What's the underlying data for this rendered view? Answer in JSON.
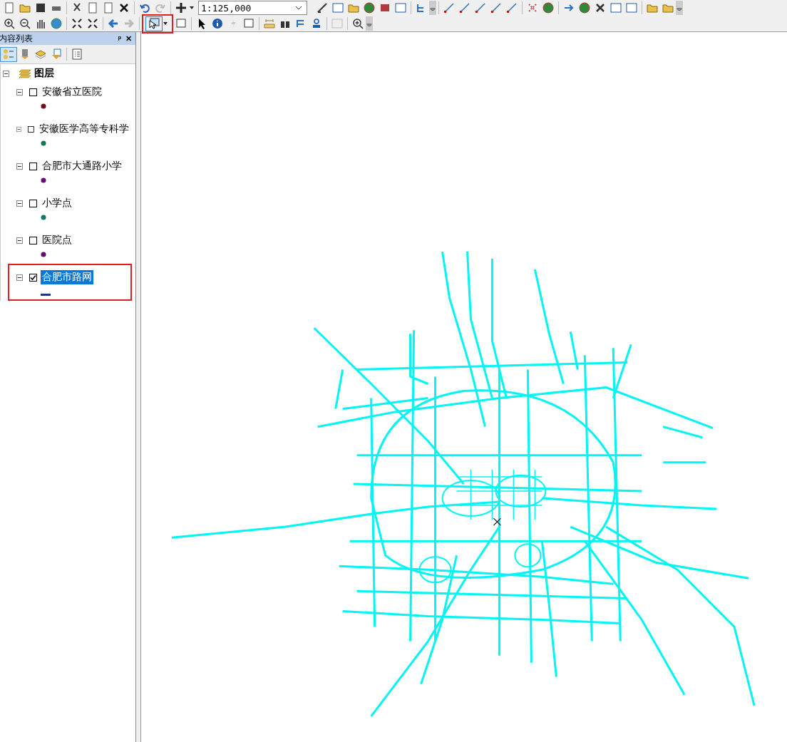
{
  "toolbar": {
    "scale": "1:125,000",
    "select_tool_highlighted": true
  },
  "toc": {
    "title": "内容列表",
    "pin": "ᵖ",
    "close": "✕",
    "root": {
      "label": "图层",
      "expanded": true,
      "layers": [
        {
          "label": "安徽省立医院",
          "checked": false,
          "expanded": true,
          "selected": false,
          "highlighted": false,
          "symbol": {
            "kind": "point",
            "color": "#7a0a1a"
          }
        },
        {
          "label": "安徽医学高等专科学",
          "checked": false,
          "expanded": true,
          "selected": false,
          "highlighted": false,
          "symbol": {
            "kind": "point",
            "color": "#0a7a5a"
          }
        },
        {
          "label": "合肥市大通路小学",
          "checked": false,
          "expanded": true,
          "selected": false,
          "highlighted": false,
          "symbol": {
            "kind": "point",
            "color": "#6a0a7a"
          }
        },
        {
          "label": "小学点",
          "checked": false,
          "expanded": true,
          "selected": false,
          "highlighted": false,
          "symbol": {
            "kind": "point",
            "color": "#0a7a6a"
          }
        },
        {
          "label": "医院点",
          "checked": false,
          "expanded": true,
          "selected": false,
          "highlighted": false,
          "symbol": {
            "kind": "point",
            "color": "#6a0a6a"
          }
        },
        {
          "label": "合肥市路网",
          "checked": true,
          "expanded": true,
          "selected": true,
          "highlighted": true,
          "symbol": {
            "kind": "line",
            "color": "#1a3a8a"
          }
        }
      ]
    }
  }
}
